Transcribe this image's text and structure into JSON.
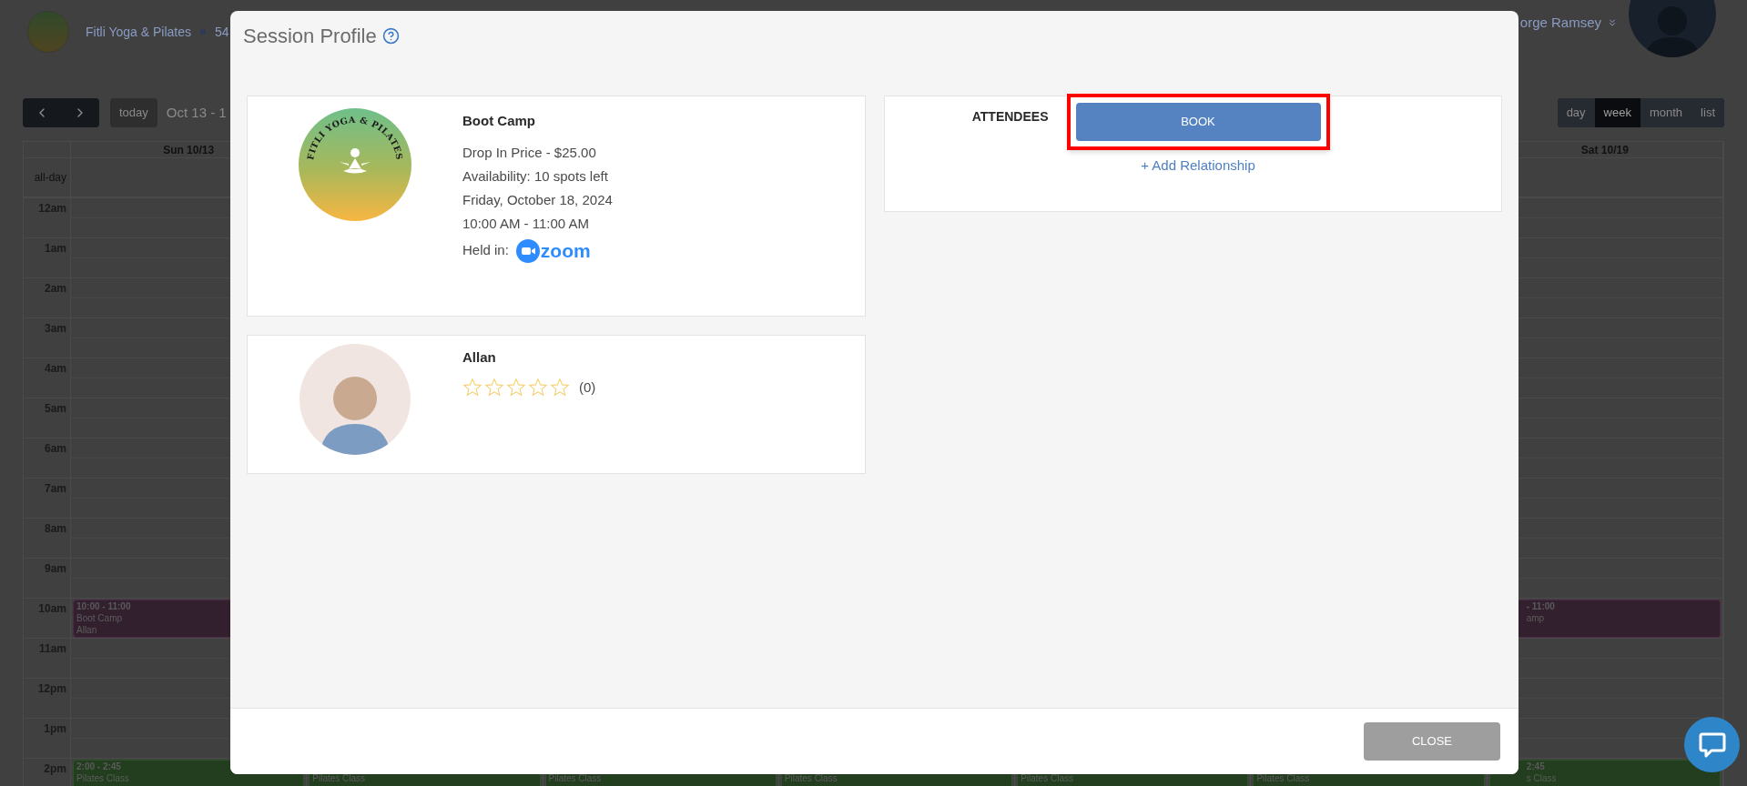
{
  "header": {
    "brand": "Fitli Yoga & Pilates",
    "location": "54",
    "user_name": "orge Ramsey"
  },
  "toolbar": {
    "today": "today",
    "date_range": "Oct 13 - 1",
    "views": [
      {
        "label": "day",
        "selected": false
      },
      {
        "label": "week",
        "selected": true
      },
      {
        "label": "month",
        "selected": false
      },
      {
        "label": "list",
        "selected": false
      }
    ]
  },
  "calendar": {
    "day_headers": [
      {
        "kind": "first_day",
        "label": "Sun 10/13"
      },
      {
        "kind": "last_day",
        "label": "Sat 10/19"
      }
    ],
    "all_day_label": "all-day",
    "hours": [
      {
        "label": "12am"
      },
      {
        "label": "1am"
      },
      {
        "label": "2am"
      },
      {
        "label": "3am"
      },
      {
        "label": "4am"
      },
      {
        "label": "5am"
      },
      {
        "label": "6am"
      },
      {
        "label": "7am"
      },
      {
        "label": "8am"
      },
      {
        "label": "9am"
      },
      {
        "label": "10am",
        "cells": [
          {
            "kind": "boot_camp",
            "time": "10:00 - 11:00",
            "title": "Boot Camp",
            "instructor": "Allan"
          },
          {},
          {},
          {},
          {},
          {},
          {
            "kind": "boot_camp",
            "time": "- 11:00",
            "title": "amp",
            "covered": true
          }
        ]
      },
      {
        "label": "11am"
      },
      {
        "label": "12pm"
      },
      {
        "label": "1pm"
      },
      {
        "label": "2pm",
        "cells": [
          {
            "kind": "pilates",
            "time": "2:00 - 2:45",
            "title": "Pilates Class"
          },
          {
            "kind": "pilates",
            "title": "Pilates Class"
          },
          {
            "kind": "pilates",
            "title": "Pilates Class"
          },
          {
            "kind": "pilates",
            "title": "Pilates Class"
          },
          {
            "kind": "pilates",
            "title": "Pilates Class"
          },
          {
            "kind": "pilates",
            "title": "Pilates Class"
          },
          {
            "kind": "pilates",
            "time": "2:45",
            "title": "s Class",
            "covered": true
          }
        ]
      }
    ]
  },
  "modal": {
    "title": "Session Profile",
    "session": {
      "logo_text": "FITLI YOGA & PILATES",
      "name": "Boot Camp",
      "details": [
        "Drop In Price - $25.00",
        "Availability: 10 spots left",
        "Friday, October 18, 2024",
        "10:00 AM - 11:00 AM"
      ],
      "held_in_label": "Held in:",
      "platform": "zoom"
    },
    "instructor": {
      "name": "Allan",
      "stars": 0,
      "review_count": "(0)"
    },
    "attendees": {
      "label": "ATTENDEES",
      "book_button": "BOOK",
      "add_relationship": "+ Add Relationship"
    },
    "close_button": "CLOSE"
  }
}
